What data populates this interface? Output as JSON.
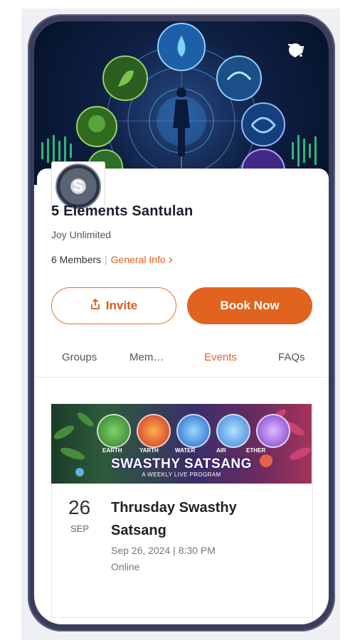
{
  "header": {
    "icons": [
      "chat-icon",
      "bell-icon",
      "cart-icon"
    ]
  },
  "group": {
    "avatar_initial": "S",
    "name": "5 Elements Santulan",
    "owner": "Joy Unlimited",
    "members": "6 Members",
    "separator": "|",
    "general_info": "General Info",
    "chevron": "›"
  },
  "actions": {
    "invite_label": "Invite",
    "invite_icon": "⇪",
    "book_label": "Book Now"
  },
  "tabs": [
    {
      "label": "Groups",
      "active": false
    },
    {
      "label": "Mem…",
      "active": false
    },
    {
      "label": "Events",
      "active": true
    },
    {
      "label": "FAQs",
      "active": false
    }
  ],
  "event": {
    "banner": {
      "elements": [
        "EARTH",
        "YARTH",
        "WATER",
        "AIR",
        "ETHER"
      ],
      "title": "SWASTHY SATSANG",
      "subtitle": "A WEEKLY LIVE PROGRAM"
    },
    "day": "26",
    "month": "SEP",
    "title": "Thrusday Swasthy Satsang",
    "when": "Sep 26, 2024 | 8:30 PM",
    "where": "Online"
  },
  "colors": {
    "accent": "#e0641f",
    "frame": "#3a3e5c",
    "hero_bg": "#0f2044"
  }
}
